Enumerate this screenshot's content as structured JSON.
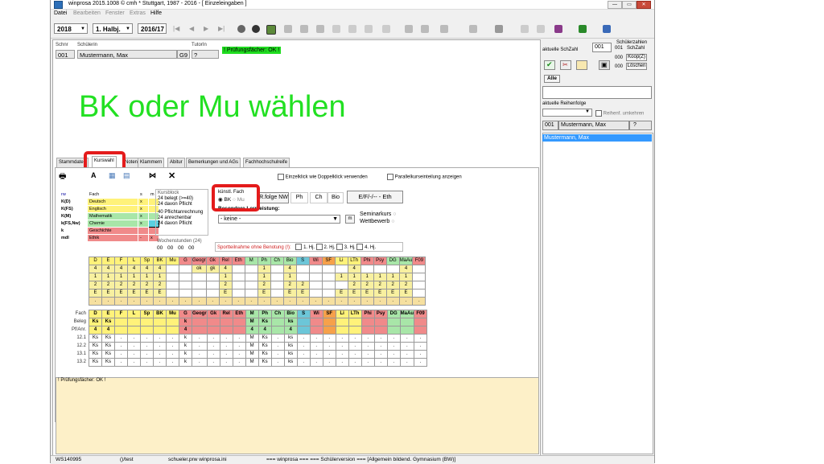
{
  "window": {
    "title": "winprosa 2015.1008 © cmh * Stuttgart, 1987 - 2016 - [ Einzeleingaben ]",
    "min": "—",
    "max": "▭",
    "close": "✕"
  },
  "menu": [
    "Datei",
    "Bearbeiten",
    "Fenster",
    "Extras",
    "Hilfe"
  ],
  "toolbar": {
    "year": "2018",
    "halfyear": "1. Halbj.",
    "schoolyear": "2016/17",
    "nav": [
      "|◀",
      "◀",
      "▶",
      "▶|"
    ]
  },
  "student": {
    "schnr_label": "Schnr",
    "schuelerin_label": "Schülerin",
    "tutorin_label": "TutorIn",
    "schnr": "001",
    "name": "Mustermann, Max",
    "class": "G9",
    "tutor": "?",
    "ok_badge": "! Prüfungsfächer: OK !"
  },
  "overlay_text": "BK oder Mu wählen",
  "tabs": [
    "Stammdaten",
    "Kurswahl",
    "Noten",
    "Klammern",
    "Abitur",
    "Bemerkungen und AGs",
    "Fachhochschulreife"
  ],
  "kurswahl": {
    "einzelklick": "Einzelklick wie Doppelklick verwenden",
    "parallel": "Parallelkurseinteilung anzeigen",
    "a_btn": "A",
    "subject_table_header": [
      "rw",
      "Fach",
      "s",
      "m"
    ],
    "subject_rows": [
      {
        "code": "K(D)",
        "fach": "Deutsch",
        "s": "x",
        "m": "",
        "color": "#fff27a"
      },
      {
        "code": "K(FS)",
        "fach": "Englisch",
        "s": "x",
        "m": "",
        "color": "#fff27a"
      },
      {
        "code": "K(M)",
        "fach": "Mathematik",
        "s": "x",
        "m": "",
        "color": "#a8e6a8"
      },
      {
        "code": "k(FS,Nw)",
        "fach": "Chemie",
        "s": "x",
        "m": "",
        "color": "#a8e6a8"
      },
      {
        "code": "k",
        "fach": "Geschichte",
        "s": "",
        "m": "",
        "color": "#f08a8a"
      },
      {
        "code": "mdl",
        "fach": "Ethik",
        "s": "-",
        "m": "x",
        "color": "#f08a8a"
      }
    ],
    "kursblock_label": "Kursblock",
    "kursblock_lines": [
      "24 belegt (>=40)",
      "24  davon Pflicht"
    ],
    "pflicht_lines": [
      "40  Pflichtanrechnung",
      "24  anrechenbar",
      "24  davon Pflicht"
    ],
    "wochenstunden_label": "Wochenstunden (24)",
    "wochenstunden_values": [
      "00",
      "00",
      "00",
      "00"
    ],
    "kuenstl_label": "künstl. Fach",
    "kuenstl_opts": [
      "BK",
      "Mu"
    ],
    "rfolge_btn": "R.folge NW",
    "nw_btns": [
      "Ph",
      "Ch",
      "Bio"
    ],
    "eth_btn": "E/F/-/-- - Eth",
    "besondere_label": "Besondere Lernleistung:",
    "besondere_value": "- keine -",
    "seminarkurs": "Seminarkurs",
    "wettbewerb": "Wettbewerb",
    "sport_label": "Sportteilnahme ohne Benotung (!):",
    "sport_opts": [
      "1. Hj.",
      "2. Hj.",
      "3. Hj.",
      "4. Hj."
    ]
  },
  "grid": {
    "cols": [
      "D",
      "E",
      "F",
      "L",
      "Sp",
      "BK",
      "Mu",
      "G",
      "Geogr",
      "Gk",
      "Rel",
      "Eth",
      "M",
      "Ph",
      "Ch",
      "Bio",
      "S",
      "Wi",
      "SF",
      "Li",
      "LTh",
      "Phi",
      "Psy",
      "DG",
      "MaAu",
      "F09"
    ],
    "col_colors": [
      "#fff27a",
      "#fff27a",
      "#fff27a",
      "#fff27a",
      "#fff27a",
      "#fff27a",
      "#fff27a",
      "#f08a8a",
      "#f08a8a",
      "#f08a8a",
      "#f08a8a",
      "#f08a8a",
      "#a8e6a8",
      "#a8e6a8",
      "#a8e6a8",
      "#a8e6a8",
      "#6cc6d8",
      "#f08a8a",
      "#f6a14a",
      "#fff27a",
      "#fff27a",
      "#f08a8a",
      "#f08a8a",
      "#a8e6a8",
      "#a8e6a8",
      "#f08a8a"
    ],
    "top_rows": [
      [
        "4",
        "4",
        "4",
        "4",
        "4",
        "4",
        "",
        "",
        "ok",
        "gk",
        "4",
        "",
        "",
        "1",
        "",
        "4",
        "",
        "",
        "",
        "",
        "4",
        "",
        "",
        "",
        "4",
        ""
      ],
      [
        "1",
        "1",
        "1",
        "1",
        "1",
        "1",
        "",
        "",
        "",
        "",
        "1",
        "",
        "",
        "1",
        "",
        "1",
        "",
        "",
        "",
        "1",
        "1",
        "1",
        "1",
        "1",
        "1",
        ""
      ],
      [
        "2",
        "2",
        "2",
        "2",
        "2",
        "2",
        "",
        "",
        "",
        "",
        "2",
        "",
        "",
        "2",
        "",
        "2",
        "2",
        "",
        "",
        "",
        "2",
        "2",
        "2",
        "2",
        "2",
        ""
      ],
      [
        "E",
        "E",
        "E",
        "E",
        "E",
        "E",
        "",
        "",
        "",
        "",
        "E",
        "",
        "",
        "E",
        "",
        "E",
        "E",
        "",
        "",
        "E",
        "E",
        "E",
        "E",
        "E",
        "E",
        ""
      ],
      [
        ".",
        ".",
        ".",
        ".",
        ".",
        ".",
        ".",
        ".",
        ".",
        ".",
        ".",
        ".",
        ".",
        ".",
        ".",
        ".",
        ".",
        ".",
        ".",
        ".",
        ".",
        ".",
        ".",
        ".",
        ".",
        "."
      ]
    ],
    "bottom_labels": [
      "Fach",
      "Beleg",
      "Pf/Anr.",
      "12.1",
      "12.2",
      "13.1",
      "13.2"
    ],
    "bottom_rows": [
      [
        "D",
        "E",
        "F",
        "L",
        "Sp",
        "BK",
        "Mu",
        "G",
        "Geogr",
        "Gk",
        "Rel",
        "Eth",
        "M",
        "Ph",
        "Ch",
        "Bio",
        "S",
        "Wi",
        "SF",
        "Li",
        "LTh",
        "Phi",
        "Psy",
        "DG",
        "MaAu",
        "F09"
      ],
      [
        "Ks",
        "Ks",
        "",
        "",
        "",
        "",
        "",
        "k",
        "",
        "",
        "",
        "",
        "M",
        "Ks",
        "",
        "ks",
        "",
        "",
        "",
        "",
        "",
        "",
        "",
        "",
        "",
        ""
      ],
      [
        "4",
        "4",
        "",
        "",
        "",
        "",
        "",
        "4",
        "",
        "",
        "",
        "",
        "4",
        "4",
        "",
        "4",
        "",
        "",
        "",
        "",
        "",
        "",
        "",
        "",
        "",
        ""
      ],
      [
        "Ks",
        "Ks",
        ".",
        ".",
        ".",
        ".",
        ".",
        "k",
        ".",
        ".",
        ".",
        ".",
        "M",
        "Ks",
        ".",
        "ks",
        ".",
        ".",
        ".",
        ".",
        ".",
        ".",
        ".",
        ".",
        ".",
        "."
      ],
      [
        "Ks",
        "Ks",
        ".",
        ".",
        ".",
        ".",
        ".",
        "k",
        ".",
        ".",
        ".",
        ".",
        "M",
        "Ks",
        ".",
        "ks",
        ".",
        ".",
        ".",
        ".",
        ".",
        ".",
        ".",
        ".",
        ".",
        "."
      ],
      [
        "Ks",
        "Ks",
        ".",
        ".",
        ".",
        ".",
        ".",
        "k",
        ".",
        ".",
        ".",
        ".",
        "M",
        "Ks",
        ".",
        "ks",
        ".",
        ".",
        ".",
        ".",
        ".",
        ".",
        ".",
        ".",
        ".",
        "."
      ],
      [
        "Ks",
        "Ks",
        ".",
        ".",
        ".",
        ".",
        ".",
        "k",
        ".",
        ".",
        ".",
        ".",
        "M",
        "Ks",
        ".",
        "ks",
        ".",
        ".",
        ".",
        ".",
        ".",
        ".",
        ".",
        ".",
        ".",
        "."
      ]
    ]
  },
  "message": "! Prüfungsfächer: OK !",
  "status": {
    "ws": "WS140995",
    "path": "()/test",
    "files": "schueler.prw   winprosa.ini",
    "info": "=== winprosa === === Schülerversion === [Allgemein bildend. Gymnasium (BW)]"
  },
  "side": {
    "aktuelle_label": "aktuelle SchZahl",
    "aktuelle_value": "001",
    "schuelerzahlen_label": "Schülerzahlen",
    "counts": [
      {
        "n": "001",
        "label": "SchZahl"
      },
      {
        "n": "000",
        "label": "Koop(Z)"
      },
      {
        "n": "000",
        "label": "Löschen"
      }
    ],
    "alle_btn": "Alle",
    "reihenfolge_label": "aktuelle Reihenfolge",
    "reihenf_umkehren": "Reihenf. umkehren",
    "current_row": {
      "nr": "001",
      "name": "Mustermann, Max",
      "q": "?"
    },
    "list_selected": "Mustermann, Max"
  }
}
